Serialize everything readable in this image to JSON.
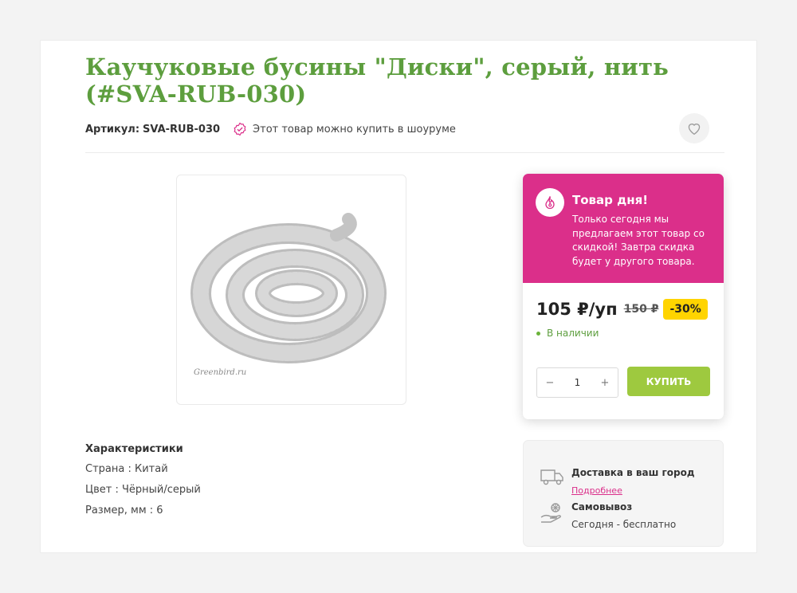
{
  "product": {
    "title": "Каучуковые бусины \"Диски\", серый, нить (#SVA-RUB-030)",
    "sku_label": "Артикул:",
    "sku": "SVA-RUB-030",
    "showroom_text": "Этот товар можно купить в шоуруме",
    "image_watermark": "Greenbird.ru"
  },
  "characteristics": {
    "title": "Характеристики",
    "rows": [
      "Страна : Китай",
      "Цвет : Чёрный/серый",
      "Размер, мм : 6"
    ]
  },
  "deal": {
    "title": "Товар дня!",
    "text": "Только сегодня мы предлагаем этот товар со скидкой! Завтра скидка будет у другого товара.",
    "price": "105 ₽/уп",
    "old_price": "150 ₽",
    "discount": "-30%",
    "stock": "В наличии",
    "quantity": "1",
    "minus": "−",
    "plus": "+",
    "buy_label": "КУПИТЬ",
    "accent_color": "#db2f8a"
  },
  "delivery": {
    "title": "Доставка в ваш город",
    "link": "Подробнее",
    "pickup_title": "Самовывоз",
    "pickup_text": "Сегодня - бесплатно"
  },
  "icons": {
    "favorite": "heart-icon",
    "showroom": "badge-check-icon",
    "deal": "fire-icon",
    "delivery": "truck-icon",
    "pickup": "hand-box-icon"
  }
}
